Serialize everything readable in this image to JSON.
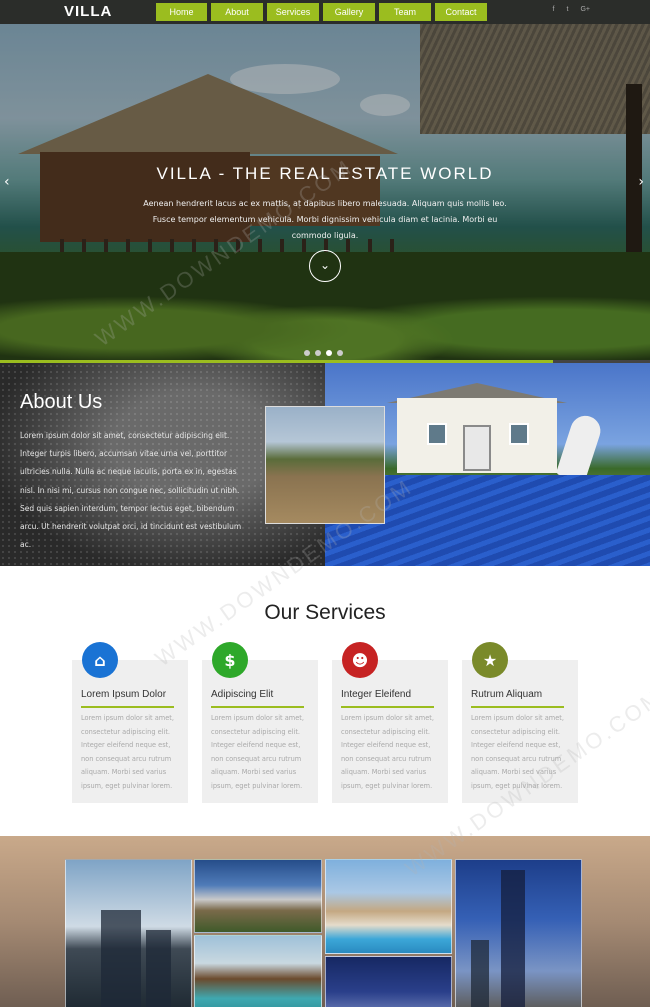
{
  "nav": {
    "brand": "VILLA",
    "items": [
      {
        "label": "Home"
      },
      {
        "label": "About"
      },
      {
        "label": "Services"
      },
      {
        "label": "Gallery"
      },
      {
        "label": "Team"
      },
      {
        "label": "Contact"
      }
    ],
    "social": [
      "f",
      "t",
      "G+"
    ]
  },
  "hero": {
    "title": "VILLA - THE REAL ESTATE WORLD",
    "text": "Aenean hendrerit lacus ac ex mattis, at dapibus libero malesuada. Aliquam quis mollis leo. Fusce tempor elementum vehicula. Morbi dignissim vehicula diam et lacinia. Morbi eu commodo ligula.",
    "button_glyph": "⌄",
    "slides": 4,
    "active_slide": 3,
    "progress": 0.85
  },
  "about": {
    "title": "About Us",
    "text": "Lorem ipsum dolor sit amet, consectetur adipiscing elit. Integer turpis libero, accumsan vitae urna vel, porttitor ultricies nulla. Nulla ac neque iaculis, porta ex in, egestas nisl. In nisi mi, cursus non congue nec, sollicitudin ut nibh. Sed quis sapien interdum, tempor lectus eget, bibendum arcu. Ut hendrerit volutpat orci, id tincidunt est vestibulum ac."
  },
  "services": {
    "title": "Our Services",
    "items": [
      {
        "title": "Lorem Ipsum Dolor",
        "icon": "house-icon",
        "color": "#1a73d4",
        "glyph": "⌂",
        "text": "Lorem ipsum dolor sit amet, consectetur adipiscing elit. Integer eleifend neque est, non consequat arcu rutrum aliquam. Morbi sed varius ipsum, eget pulvinar lorem."
      },
      {
        "title": "Adipiscing Elit",
        "icon": "dollar-icon",
        "color": "#2ea82a",
        "glyph": "$",
        "text": "Lorem ipsum dolor sit amet, consectetur adipiscing elit. Integer eleifend neque est, non consequat arcu rutrum aliquam. Morbi sed varius ipsum, eget pulvinar lorem."
      },
      {
        "title": "Integer Eleifend",
        "icon": "person-icon",
        "color": "#c62323",
        "glyph": "☻",
        "text": "Lorem ipsum dolor sit amet, consectetur adipiscing elit. Integer eleifend neque est, non consequat arcu rutrum aliquam. Morbi sed varius ipsum, eget pulvinar lorem."
      },
      {
        "title": "Rutrum Aliquam",
        "icon": "award-icon",
        "color": "#7a8a2a",
        "glyph": "★",
        "text": "Lorem ipsum dolor sit amet, consectetur adipiscing elit. Integer eleifend neque est, non consequat arcu rutrum aliquam. Morbi sed varius ipsum, eget pulvinar lorem."
      }
    ]
  },
  "colors": {
    "accent": "#9bbd1f",
    "nav_bg": "#2b2d2a"
  }
}
